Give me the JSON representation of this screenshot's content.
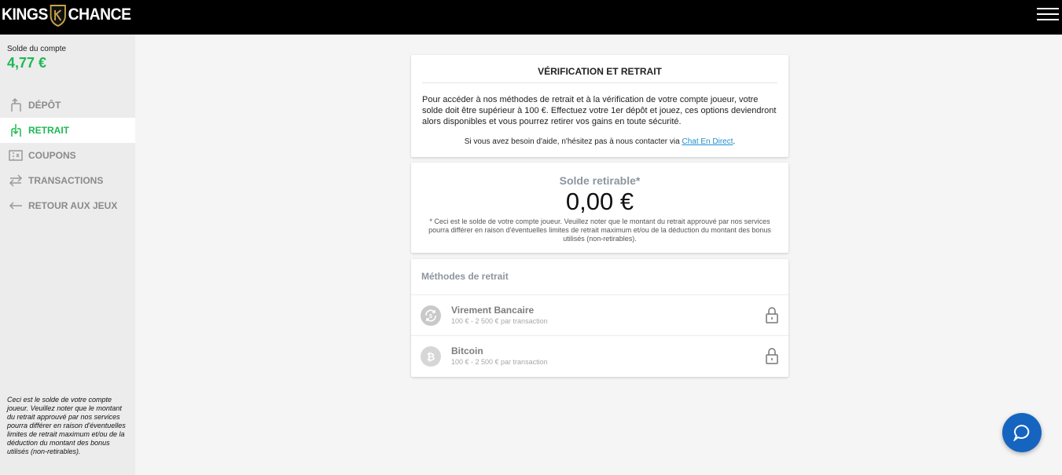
{
  "header": {
    "logo_left": "KINGS",
    "logo_right": "CHANCE"
  },
  "sidebar": {
    "balance_label": "Solde du compte",
    "balance_value": "4,77 €",
    "items": [
      {
        "label": "DÉPÔT",
        "icon": "deposit-icon"
      },
      {
        "label": "RETRAIT",
        "icon": "withdraw-icon",
        "active": true
      },
      {
        "label": "COUPONS",
        "icon": "coupon-icon"
      },
      {
        "label": "TRANSACTIONS",
        "icon": "transactions-icon"
      },
      {
        "label": "RETOUR AUX JEUX",
        "icon": "back-arrow-icon"
      }
    ],
    "note": "Ceci est le solde de votre compte joueur. Veuillez noter que le montant du retrait approuvé par nos services pourra différer en raison d'éventuelles limites de retrait maximum et/ou de la déduction du montant des bonus utilisés (non-retirables)."
  },
  "verification": {
    "title": "VÉRIFICATION ET RETRAIT",
    "body": "Pour accéder à nos méthodes de retrait et à la vérification de votre compte joueur, votre solde doit être supérieur à 100 €. Effectuez votre 1er dépôt et jouez, ces options deviendront alors disponibles et vous pourrez retirer vos gains en toute sécurité.",
    "help_prefix": "Si vous avez besoin d'aide, n'hésitez pas à nous contacter via ",
    "help_link": "Chat En Direct",
    "help_suffix": "."
  },
  "withdrawable": {
    "label": "Solde retirable*",
    "amount": "0,00 €",
    "note": "* Ceci est le solde de votre compte joueur. Veuillez noter que le montant du retrait approuvé par nos services pourra différer en raison d'éventuelles limites de retrait maximum et/ou de la déduction du montant des bonus utilisés (non-retirables)."
  },
  "methods": {
    "title": "Méthodes de retrait",
    "items": [
      {
        "name": "Virement Bancaire",
        "range": "100 € - 2 500 € par transaction",
        "icon": "bank-transfer-icon",
        "locked": true
      },
      {
        "name": "Bitcoin",
        "range": "100 € - 2 500 € par transaction",
        "icon": "bitcoin-icon",
        "locked": true
      }
    ]
  },
  "colors": {
    "accent_green": "#1db954",
    "chat_blue": "#1565c0",
    "topbar": "#000000"
  }
}
